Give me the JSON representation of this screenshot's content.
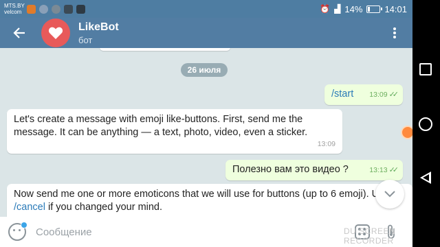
{
  "status_bar": {
    "carrier_line1": "MTS.BY",
    "carrier_line2": "velcom",
    "battery_percent": 14,
    "battery_label": "14%",
    "time": "14:01"
  },
  "header": {
    "title": "LikeBot",
    "subtitle": "бот"
  },
  "chat": {
    "date_separator": "26 июля",
    "messages": [
      {
        "direction": "out",
        "text": "/start",
        "time": "13:09",
        "read": true
      },
      {
        "direction": "in",
        "text": "Let's create a message with emoji like-buttons. First, send me the message. It can be anything — a text, photo, video, even a sticker.",
        "time": "13:09"
      },
      {
        "direction": "out",
        "text": "Полезно вам это видео ?",
        "time": "13:13",
        "read": true
      },
      {
        "direction": "in",
        "text_before_link": "Now send me one or more emoticons that we will use for buttons (up to 6 emoji). Use ",
        "link": "/cancel",
        "text_after_link": " if you changed your mind."
      }
    ]
  },
  "input": {
    "placeholder": "Сообщение"
  },
  "watermark": "DU SCREEN RECORDER",
  "colors": {
    "header": "#527da3",
    "status_bar": "#4e7da2",
    "chat_background": "#dbe5e7",
    "outgoing_bubble": "#efffde",
    "incoming_bubble": "#ffffff",
    "avatar": "#e85a5a",
    "link": "#2a7ab8"
  },
  "icons": {
    "back": "arrow-left-icon",
    "menu": "more-vert-icon",
    "avatar": "heart-icon",
    "scroll": "chevron-down-icon",
    "emoji": "smiley-icon",
    "bot_commands": "bot-commands-icon",
    "attach": "paperclip-icon"
  }
}
